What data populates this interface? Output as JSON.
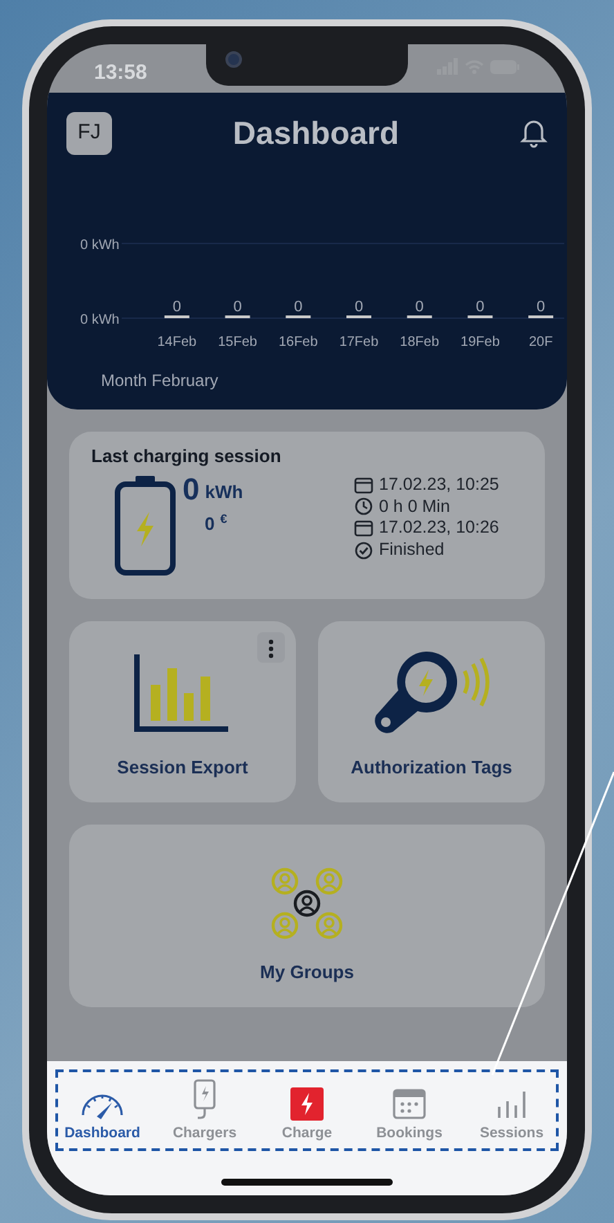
{
  "status_bar": {
    "time": "13:58"
  },
  "header": {
    "avatar_initials": "FJ",
    "title": "Dashboard"
  },
  "usage_chart": {
    "y_labels": [
      "0 kWh",
      "0 kWh"
    ],
    "days": [
      "14Feb",
      "15Feb",
      "16Feb",
      "17Feb",
      "18Feb",
      "19Feb",
      "20F"
    ],
    "value_labels": [
      "0",
      "0",
      "0",
      "0",
      "0",
      "0",
      "0"
    ],
    "caption": "Month February"
  },
  "last_session": {
    "title": "Last charging session",
    "energy_value": "0",
    "energy_unit": "kWh",
    "cost_value": "0",
    "cost_unit": "€",
    "details": [
      {
        "kind": "calendar",
        "text": "17.02.23, 10:25"
      },
      {
        "kind": "clock",
        "text": "0 h 0 Min"
      },
      {
        "kind": "calendar",
        "text": "17.02.23, 10:26"
      },
      {
        "kind": "check",
        "text": "Finished"
      }
    ]
  },
  "tiles": [
    {
      "kind": "export",
      "label": "Session Export",
      "has_menu": true
    },
    {
      "kind": "tags",
      "label": "Authorization Tags",
      "has_menu": false
    },
    {
      "kind": "groups",
      "label": "My Groups",
      "has_menu": false
    }
  ],
  "bottom_nav": [
    {
      "kind": "dashboard",
      "label": "Dashboard",
      "selected": true
    },
    {
      "kind": "chargers",
      "label": "Chargers",
      "selected": false
    },
    {
      "kind": "charge",
      "label": "Charge",
      "selected": false
    },
    {
      "kind": "bookings",
      "label": "Bookings",
      "selected": false
    },
    {
      "kind": "sessions",
      "label": "Sessions",
      "selected": false
    }
  ]
}
